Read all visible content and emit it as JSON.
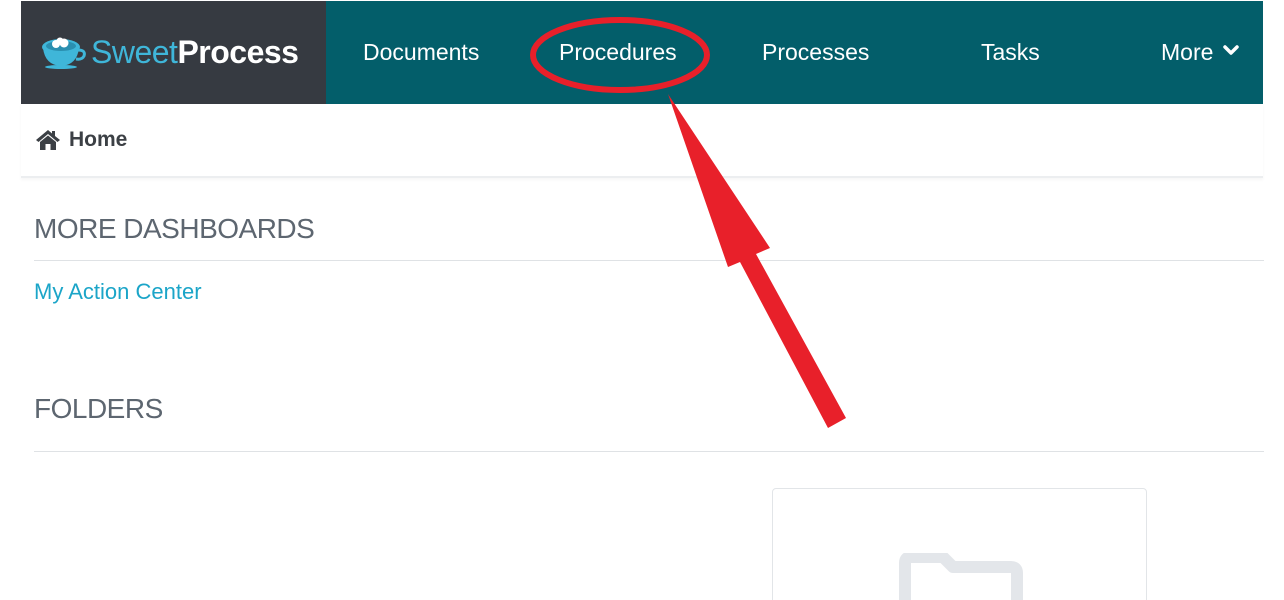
{
  "brand": {
    "name_part1": "Sweet",
    "name_part2": "Process",
    "icon": "teacup-logo-icon",
    "colors": {
      "nav_bg": "#035e6a",
      "logo_bg": "#363a41",
      "accent": "#3fb6d9",
      "link": "#1ba5c8",
      "annotation": "#e8202a"
    }
  },
  "nav": {
    "items": [
      {
        "label": "Documents"
      },
      {
        "label": "Procedures"
      },
      {
        "label": "Processes"
      },
      {
        "label": "Tasks"
      },
      {
        "label": "More",
        "icon": "chevron-down-icon"
      }
    ]
  },
  "breadcrumb": {
    "home_label": "Home",
    "home_icon": "home-icon"
  },
  "dashboards": {
    "title": "MORE DASHBOARDS",
    "links": [
      {
        "label": "My Action Center"
      }
    ]
  },
  "folders": {
    "title": "FOLDERS",
    "card_icon": "folder-icon"
  },
  "annotation": {
    "highlighted_item": "Procedures",
    "shapes": [
      "ellipse-highlight",
      "arrow-pointer"
    ]
  }
}
